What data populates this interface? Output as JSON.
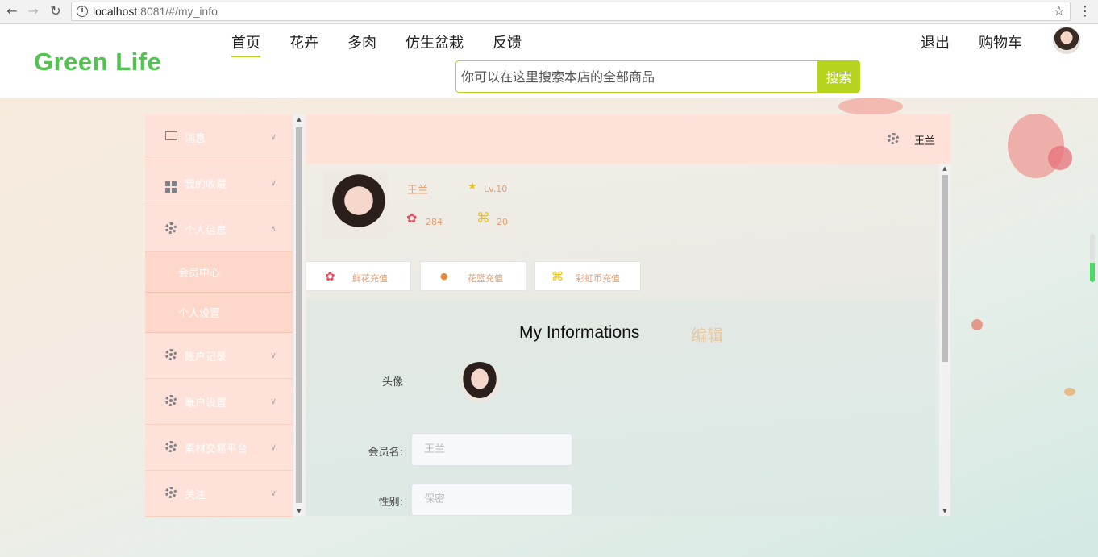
{
  "browser": {
    "url_host": "localhost",
    "url_path": ":8081/#/my_info"
  },
  "header": {
    "logo": "Green Life",
    "nav": [
      "首页",
      "花卉",
      "多肉",
      "仿生盆栽",
      "反馈"
    ],
    "right_links": [
      "退出",
      "购物车"
    ],
    "search_placeholder": "你可以在这里搜索本店的全部商品",
    "search_button": "搜索"
  },
  "sidebar": {
    "items": [
      {
        "label": "消息",
        "icon": "mail-icon"
      },
      {
        "label": "我的收藏",
        "icon": "grid-icon"
      },
      {
        "label": "个人信息",
        "icon": "gear-icon"
      },
      {
        "label": "账户记录",
        "icon": "gear-icon"
      },
      {
        "label": "账户设置",
        "icon": "gear-icon"
      },
      {
        "label": "素材交易平台",
        "icon": "gear-icon"
      },
      {
        "label": "关注",
        "icon": "gear-icon"
      }
    ],
    "sub_items": [
      "会员中心",
      "个人设置"
    ]
  },
  "panel": {
    "head_user": "王兰",
    "profile": {
      "name": "王兰",
      "level": "Lv.10",
      "flowers": "284",
      "rainbow": "20"
    },
    "recharge_buttons": [
      "鲜花充值",
      "花篮充值",
      "彩虹币充值"
    ],
    "info_title": "My Informations",
    "edit_label": "编辑",
    "labels": {
      "avatar": "头像",
      "member_name": "会员名:",
      "gender": "性别:"
    },
    "fields": {
      "member_name": "王兰",
      "gender": "保密"
    }
  },
  "colors": {
    "brand_green": "#4fc54e",
    "accent_lime": "#b6d41e",
    "sidebar_bg": "#fee1d8"
  }
}
